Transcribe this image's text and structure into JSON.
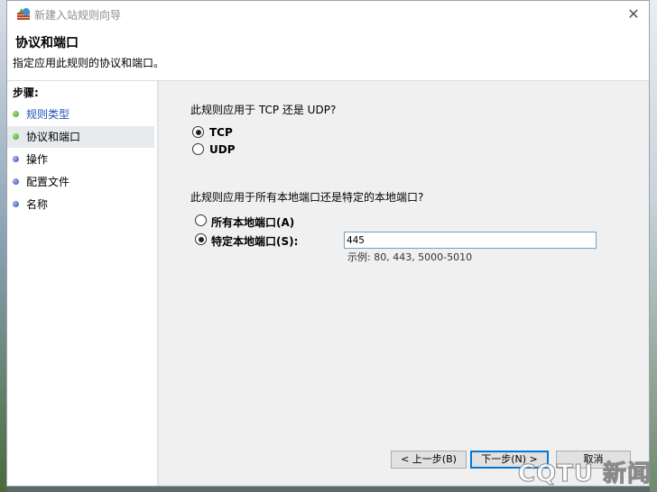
{
  "window": {
    "title": "新建入站规则向导",
    "close_symbol": "✕"
  },
  "header": {
    "title": "协议和端口",
    "description": "指定应用此规则的协议和端口。"
  },
  "steps": {
    "label": "步骤:",
    "items": [
      {
        "label": "规则类型",
        "status": "done"
      },
      {
        "label": "协议和端口",
        "status": "current"
      },
      {
        "label": "操作",
        "status": "pending"
      },
      {
        "label": "配置文件",
        "status": "pending"
      },
      {
        "label": "名称",
        "status": "pending"
      }
    ]
  },
  "protocol": {
    "question": "此规则应用于 TCP 还是 UDP?",
    "options": [
      {
        "label": "TCP",
        "selected": true
      },
      {
        "label": "UDP",
        "selected": false
      }
    ]
  },
  "ports": {
    "question": "此规则应用于所有本地端口还是特定的本地端口?",
    "options": [
      {
        "label": "所有本地端口(A)",
        "selected": false
      },
      {
        "label": "特定本地端口(S):",
        "selected": true
      }
    ],
    "value": "445",
    "example": "示例: 80, 443, 5000-5010"
  },
  "buttons": {
    "back": "< 上一步(B)",
    "next": "下一步(N) >",
    "cancel": "取消"
  },
  "watermark": "CQTU 新闻",
  "colors": {
    "done_dot": "#3c9a2c",
    "pending_dot": "#2f49b8",
    "link": "#1e53b8",
    "focus": "#0078d7"
  }
}
